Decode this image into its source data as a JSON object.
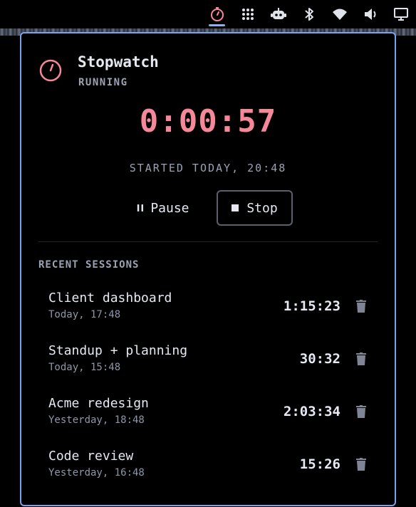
{
  "topbar": {
    "icons": [
      "stopwatch-icon",
      "apps-grid-icon",
      "robot-icon",
      "bluetooth-icon",
      "wifi-icon",
      "volume-icon",
      "display-icon"
    ],
    "active_icon": "stopwatch-icon",
    "accent_color": "#8fb0ea"
  },
  "popup": {
    "title": "Stopwatch",
    "status": "RUNNING",
    "elapsed": "0:00:57",
    "started": "STARTED TODAY, 20:48",
    "time_color": "#f7889a",
    "border_color": "#7aa2ee",
    "controls": {
      "pause_label": "Pause",
      "stop_label": "Stop"
    },
    "recent_title": "RECENT SESSIONS",
    "sessions": [
      {
        "name": "Client dashboard",
        "date": "Today, 17:48",
        "duration": "1:15:23"
      },
      {
        "name": "Standup + planning",
        "date": "Today, 15:48",
        "duration": "30:32"
      },
      {
        "name": "Acme redesign",
        "date": "Yesterday, 18:48",
        "duration": "2:03:34"
      },
      {
        "name": "Code review",
        "date": "Yesterday, 16:48",
        "duration": "15:26"
      }
    ]
  }
}
